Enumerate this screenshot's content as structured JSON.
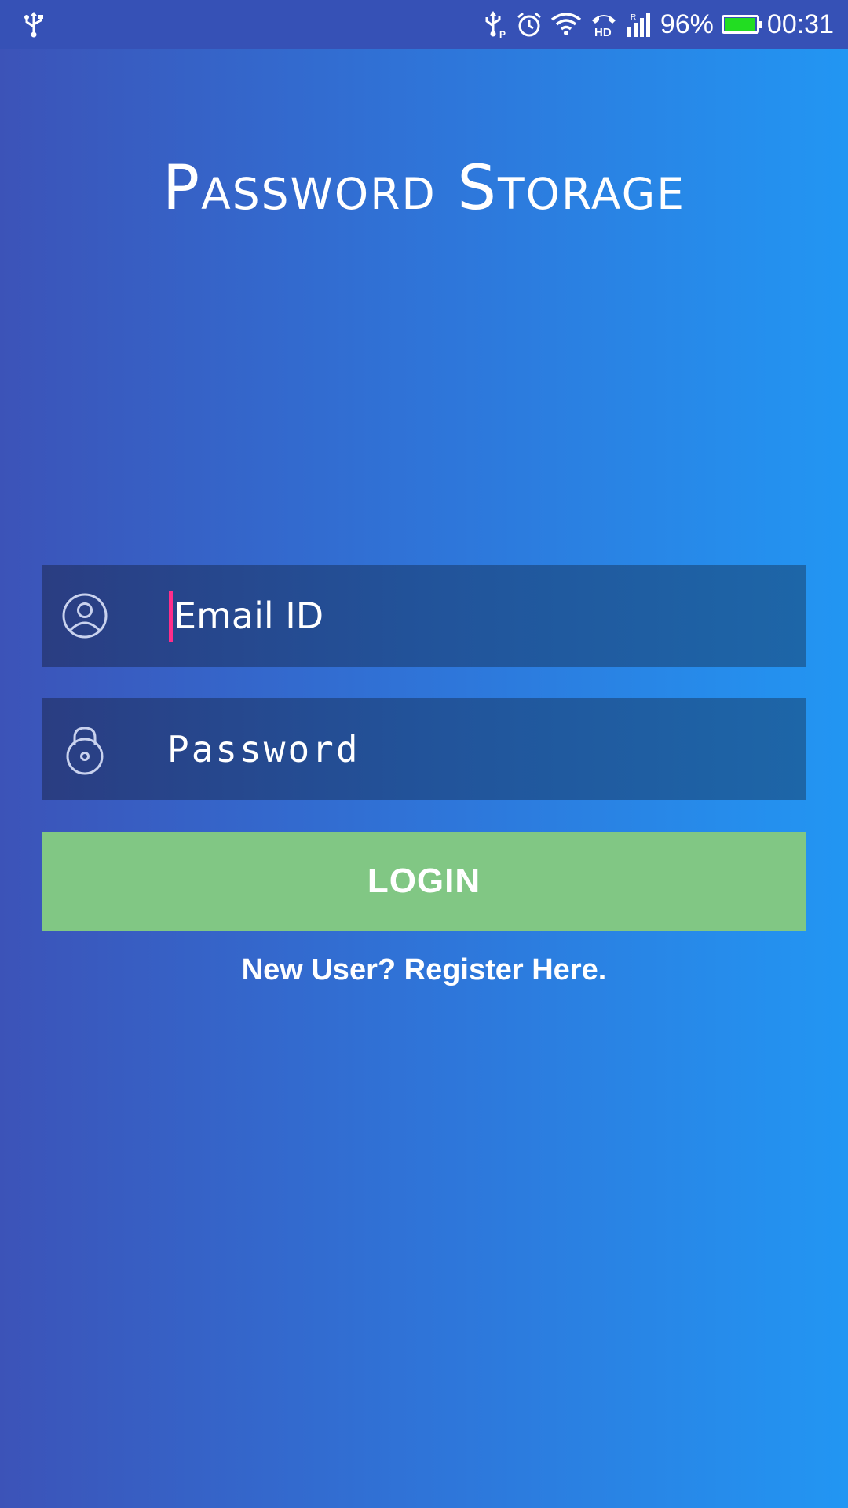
{
  "status_bar": {
    "battery_percent_text": "96%",
    "battery_level": 0.96,
    "time": "00:31",
    "icons": [
      "usb-icon",
      "usb-debug-icon",
      "alarm-icon",
      "wifi-icon",
      "hd-call-icon",
      "signal-icon",
      "battery-icon"
    ]
  },
  "app": {
    "title": "Password Storage"
  },
  "login_form": {
    "email_placeholder": "Email ID",
    "email_icon": "user-circle-icon",
    "password_placeholder": "Password",
    "password_icon": "lock-icon",
    "login_label": "LOGIN",
    "register_label": "New User? Register Here."
  },
  "colors": {
    "gradient_start": "#3c53b8",
    "gradient_end": "#2296f3",
    "button_green": "#81c784",
    "cursor_pink": "#ff2d8a"
  }
}
